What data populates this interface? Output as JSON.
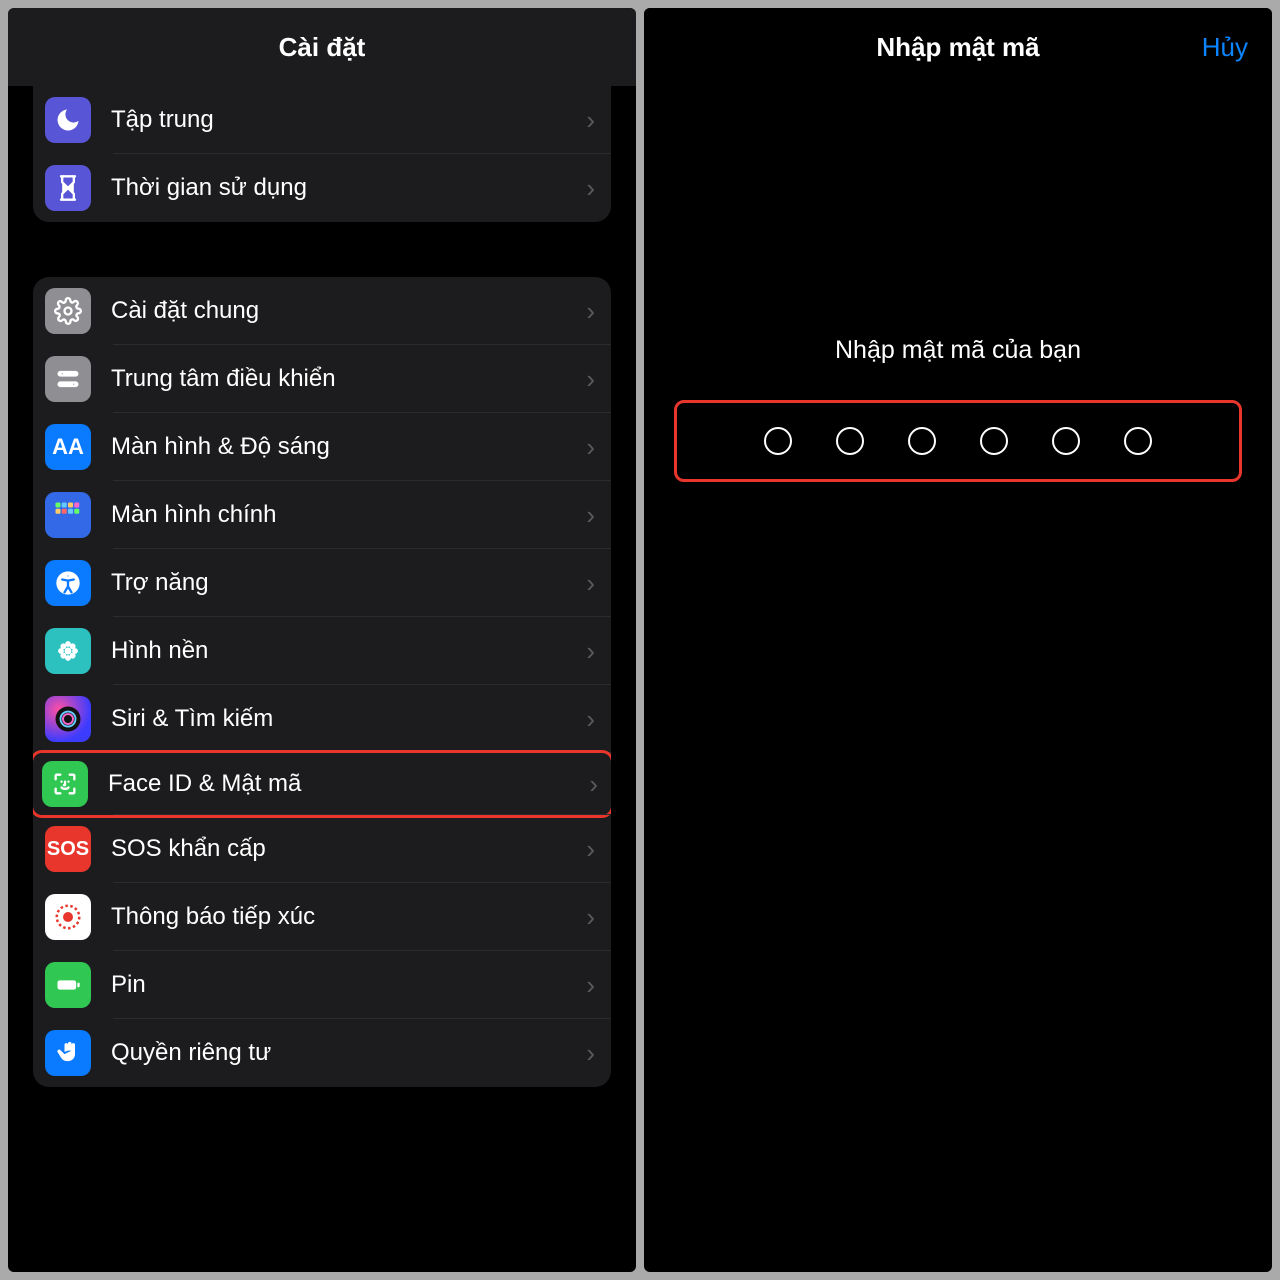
{
  "left": {
    "title": "Cài đặt",
    "group1": [
      {
        "name": "focus",
        "label": "Tập trung",
        "icon": "moon-icon",
        "bg": "bg-purple"
      },
      {
        "name": "screentime",
        "label": "Thời gian sử dụng",
        "icon": "hourglass-icon",
        "bg": "bg-purple"
      }
    ],
    "group2": [
      {
        "name": "general",
        "label": "Cài đặt chung",
        "icon": "gear-icon",
        "bg": "bg-grey"
      },
      {
        "name": "control",
        "label": "Trung tâm điều khiển",
        "icon": "switches-icon",
        "bg": "bg-grey2"
      },
      {
        "name": "display",
        "label": "Màn hình & Độ sáng",
        "icon": "text-size-icon",
        "bg": "bg-blue"
      },
      {
        "name": "home",
        "label": "Màn hình chính",
        "icon": "app-grid-icon",
        "bg": "bg-deepblue"
      },
      {
        "name": "accessibility",
        "label": "Trợ năng",
        "icon": "accessibility-icon",
        "bg": "bg-blue"
      },
      {
        "name": "wallpaper",
        "label": "Hình nền",
        "icon": "flower-icon",
        "bg": "bg-teal"
      },
      {
        "name": "siri",
        "label": "Siri & Tìm kiếm",
        "icon": "siri-icon",
        "bg": "bg-siri"
      },
      {
        "name": "faceid",
        "label": "Face ID & Mật mã",
        "icon": "faceid-icon",
        "bg": "bg-green",
        "highlight": true
      },
      {
        "name": "sos",
        "label": "SOS khẩn cấp",
        "icon": "sos-icon",
        "bg": "bg-red"
      },
      {
        "name": "exposure",
        "label": "Thông báo tiếp xúc",
        "icon": "exposure-icon",
        "bg": "bg-white"
      },
      {
        "name": "battery",
        "label": "Pin",
        "icon": "battery-icon",
        "bg": "bg-green2"
      },
      {
        "name": "privacy",
        "label": "Quyền riêng tư",
        "icon": "hand-icon",
        "bg": "bg-blue2"
      }
    ]
  },
  "right": {
    "title": "Nhập mật mã",
    "cancel": "Hủy",
    "prompt": "Nhập mật mã của bạn",
    "dot_count": 6
  }
}
